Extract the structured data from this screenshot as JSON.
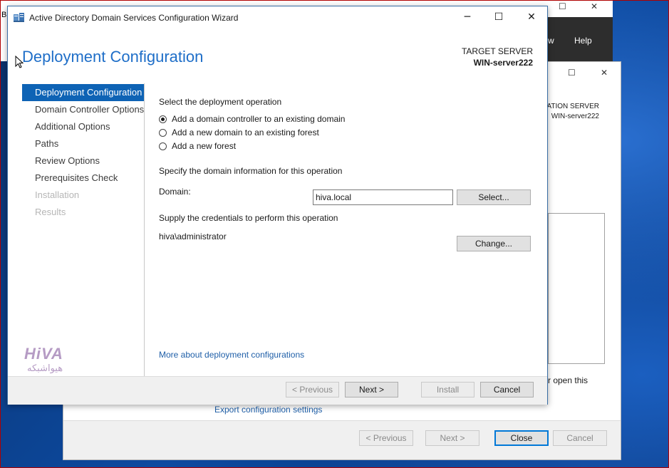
{
  "background_window": {
    "title_initial": "B",
    "menu_partial": "w",
    "menu_help": "Help"
  },
  "middle_window": {
    "target_line1": "NATION SERVER",
    "target_line2": "WIN-server222",
    "partial_text": "r open this",
    "export_link": "Export configuration settings",
    "buttons": {
      "previous": "< Previous",
      "next": "Next >",
      "close": "Close",
      "cancel": "Cancel"
    }
  },
  "dialog": {
    "title": "Active Directory Domain Services Configuration Wizard",
    "heading": "Deployment Configuration",
    "target_server_label": "TARGET SERVER",
    "target_server_name": "WIN-server222",
    "nav": [
      {
        "label": "Deployment Configuration",
        "state": "active"
      },
      {
        "label": "Domain Controller Options",
        "state": "enabled"
      },
      {
        "label": "Additional Options",
        "state": "enabled"
      },
      {
        "label": "Paths",
        "state": "enabled"
      },
      {
        "label": "Review Options",
        "state": "enabled"
      },
      {
        "label": "Prerequisites Check",
        "state": "enabled"
      },
      {
        "label": "Installation",
        "state": "disabled"
      },
      {
        "label": "Results",
        "state": "disabled"
      }
    ],
    "deployment_label": "Select the deployment operation",
    "options": [
      {
        "label": "Add a domain controller to an existing domain",
        "checked": true
      },
      {
        "label": "Add a new domain to an existing forest",
        "checked": false
      },
      {
        "label": "Add a new forest",
        "checked": false
      }
    ],
    "domain_info_label": "Specify the domain information for this operation",
    "domain_label": "Domain:",
    "domain_value": "hiva.local",
    "select_button": "Select...",
    "credentials_label": "Supply the credentials to perform this operation",
    "credentials_value": "hiva\\administrator",
    "change_button": "Change...",
    "more_link": "More about deployment configurations",
    "buttons": {
      "previous": "< Previous",
      "next": "Next >",
      "install": "Install",
      "cancel": "Cancel"
    }
  },
  "watermark": {
    "logo_text": "HiVA",
    "logo_sub": "هیواشبکه"
  },
  "colors": {
    "accent": "#1e6ec8",
    "nav_active": "#0e63b5",
    "link": "#1f5fa8"
  }
}
